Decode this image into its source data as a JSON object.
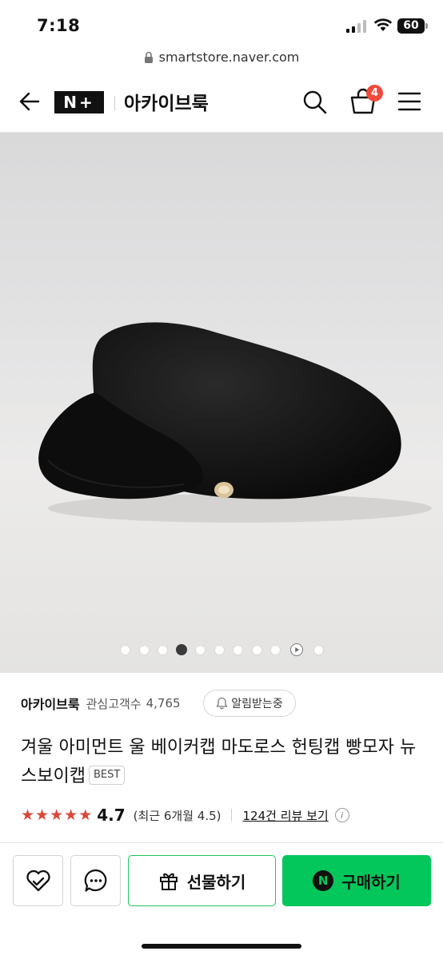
{
  "status_bar": {
    "time": "7:18",
    "battery": "60"
  },
  "browser": {
    "url": "smartstore.naver.com"
  },
  "header": {
    "logo": "N+",
    "store_title": "아카이브룩",
    "cart_count": "4"
  },
  "gallery": {
    "total_images": 11,
    "current_index": 4,
    "video_dot_index": 10
  },
  "store": {
    "name": "아카이브룩",
    "interest_label": "관심고객수",
    "interest_count": "4,765",
    "alert_label": "알림받는중"
  },
  "product": {
    "title": "겨울 아미먼트 울 베이커캡 마도로스 헌팅캡 빵모자 뉴스보이캡",
    "badge": "BEST"
  },
  "rating": {
    "stars": 4.7,
    "score": "4.7",
    "recent": "(최근 6개월 4.5)",
    "review_link": "124건 리뷰 보기"
  },
  "actions": {
    "gift_label": "선물하기",
    "buy_label": "구매하기",
    "buy_badge": "N"
  },
  "colors": {
    "accent_green": "#03c75a",
    "star_red": "#d9483b",
    "badge_red": "#f04a3b"
  }
}
